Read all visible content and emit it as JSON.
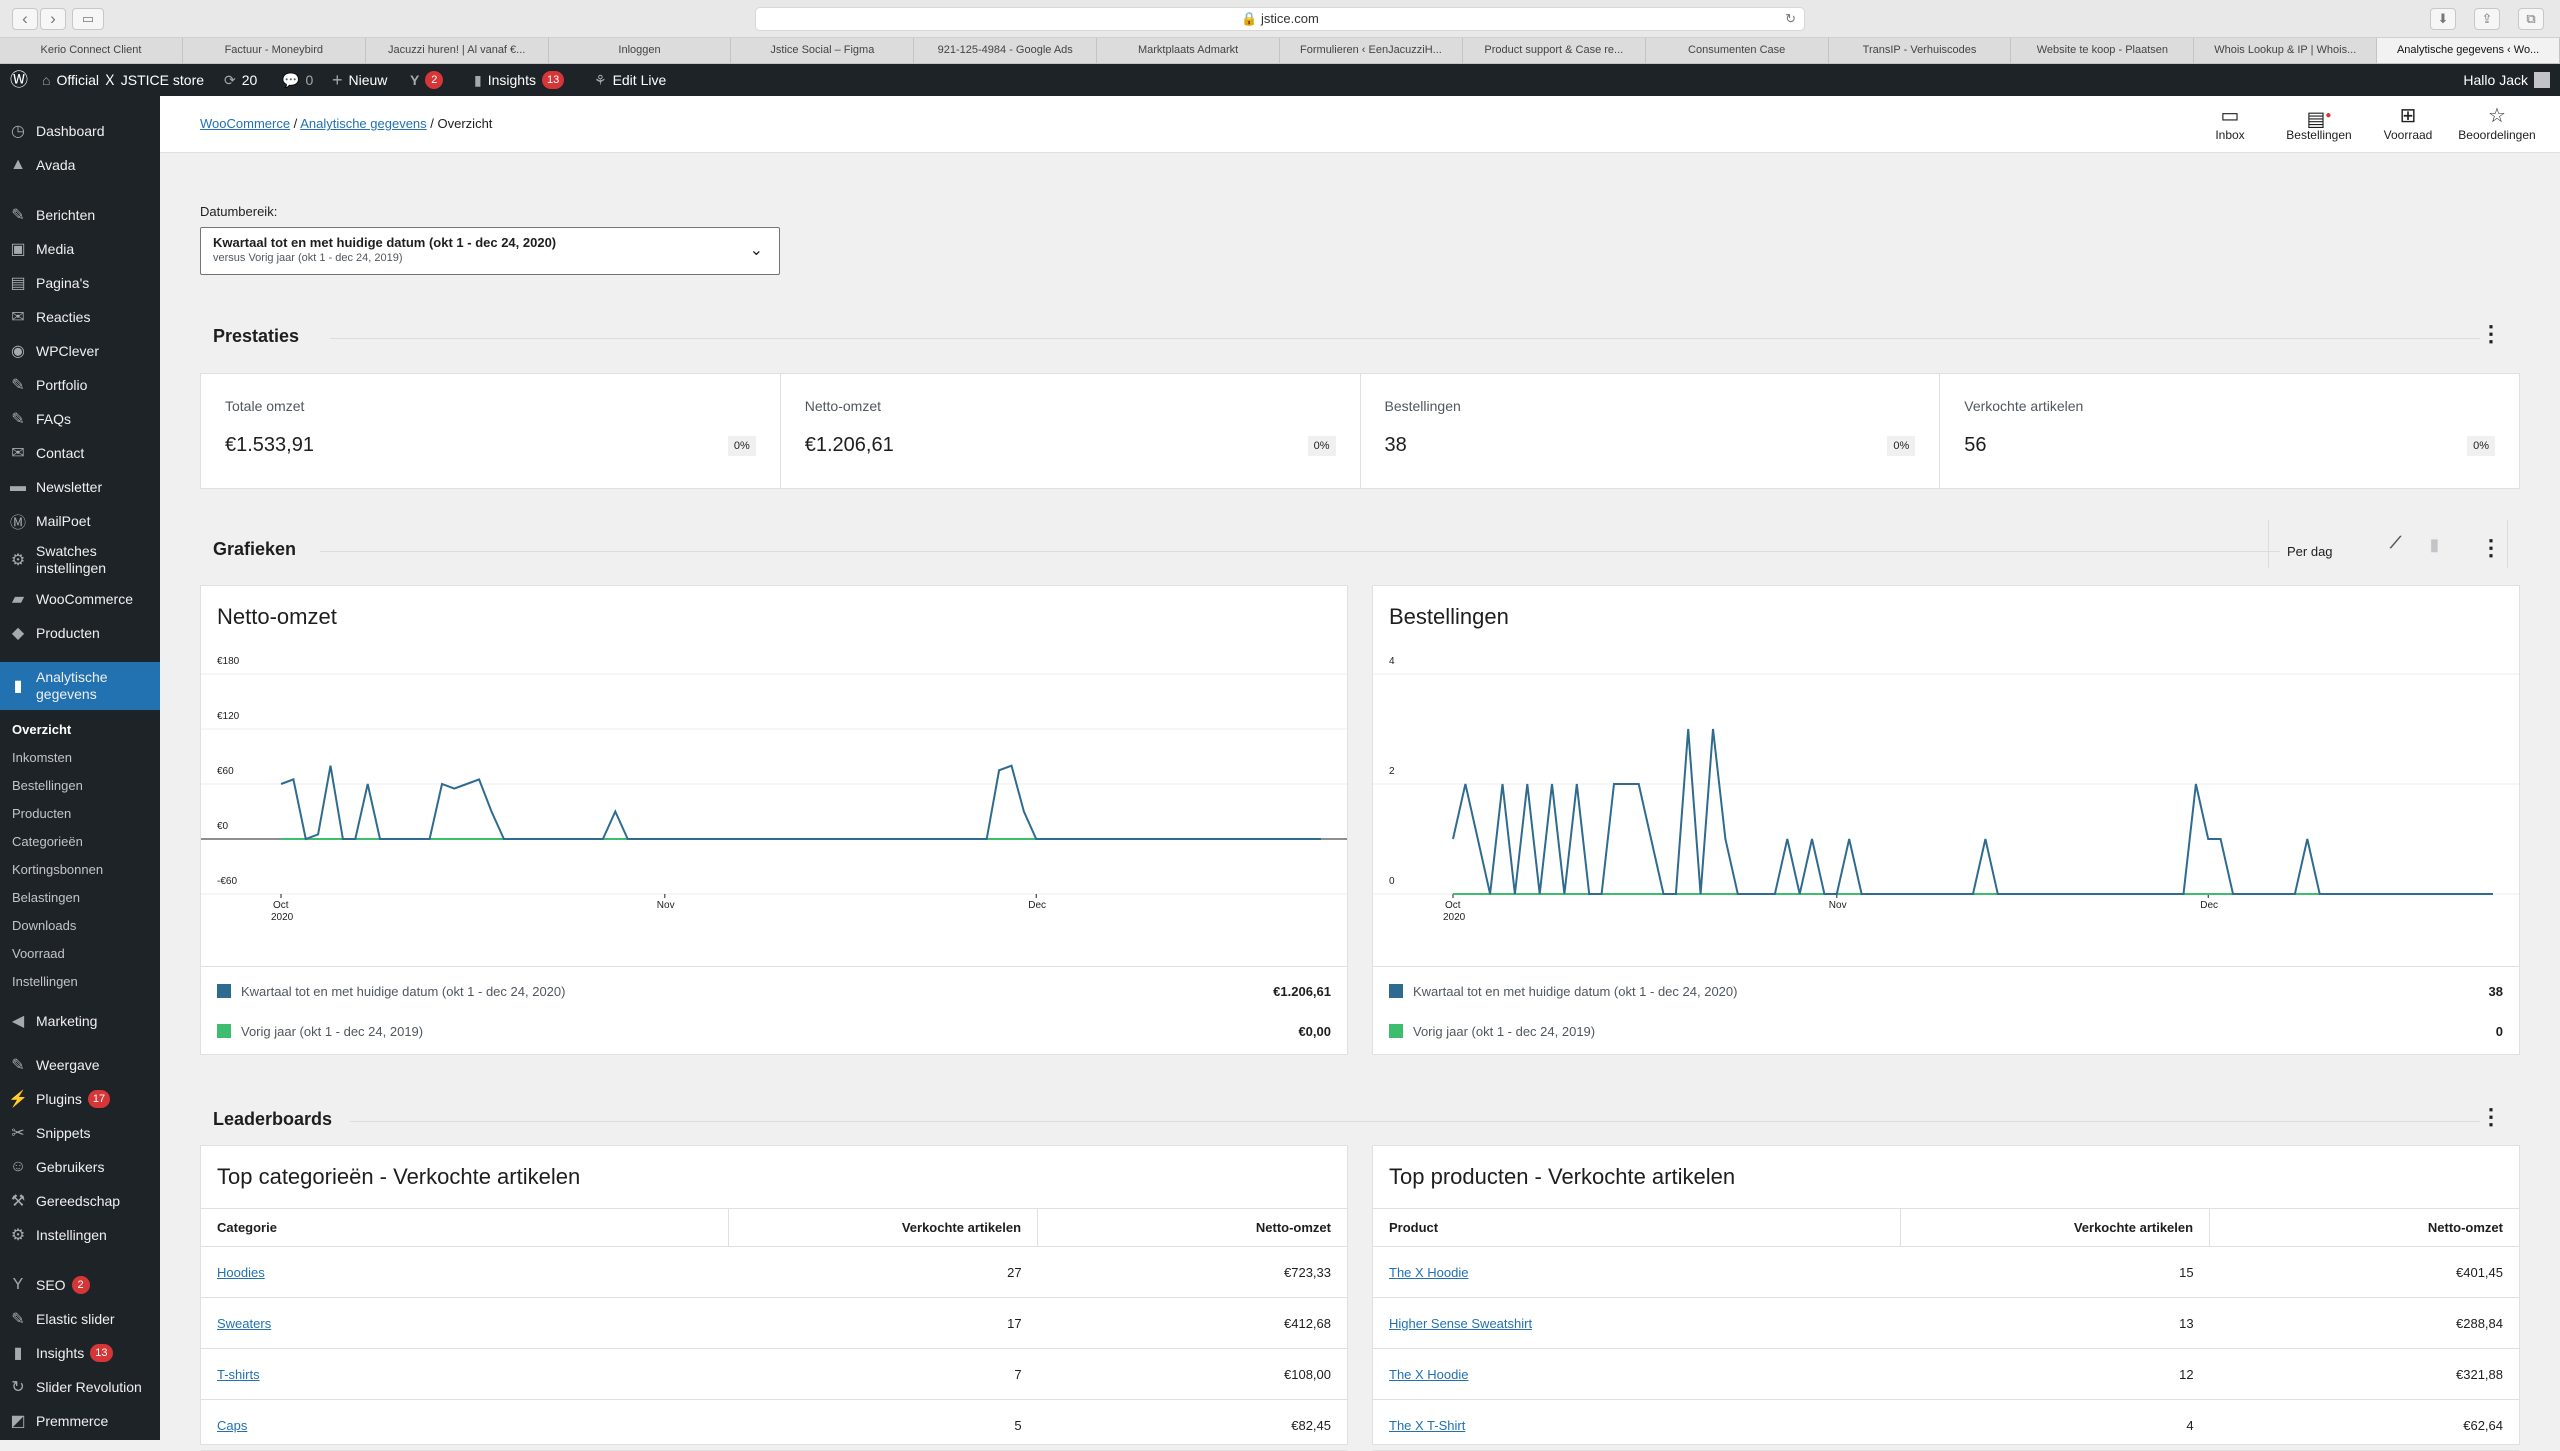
{
  "browser": {
    "url": "jstice.com",
    "tabs": [
      "Kerio Connect Client",
      "Factuur - Moneybird",
      "Jacuzzi huren! | Al vanaf €...",
      "Inloggen",
      "Jstice Social – Figma",
      "921-125-4984 - Google Ads",
      "Marktplaats Admarkt",
      "Formulieren ‹ EenJacuzziH...",
      "Product support & Case re...",
      "Consumenten Case",
      "TransIP - Verhuiscodes",
      "Website te koop - Plaatsen",
      "Whois Lookup & IP | Whois...",
      "Analytische gegevens ‹ Wo..."
    ]
  },
  "adminbar": {
    "site": "Official Ｘ JSTICE store",
    "updates": "20",
    "comments": "0",
    "new": "Nieuw",
    "yoast_badge": "2",
    "insights": "Insights",
    "insights_badge": "13",
    "edit_live": "Edit Live",
    "greeting": "Hallo Jack"
  },
  "sidebar": {
    "items": [
      {
        "label": "Dashboard",
        "icon": "dashboard-icon"
      },
      {
        "label": "Avada",
        "icon": "avada-icon"
      },
      {
        "label": "Berichten",
        "icon": "pin-icon"
      },
      {
        "label": "Media",
        "icon": "media-icon"
      },
      {
        "label": "Pagina's",
        "icon": "page-icon"
      },
      {
        "label": "Reacties",
        "icon": "comment-icon"
      },
      {
        "label": "WPClever",
        "icon": "wpclever-icon"
      },
      {
        "label": "Portfolio",
        "icon": "pin-icon"
      },
      {
        "label": "FAQs",
        "icon": "pin-icon"
      },
      {
        "label": "Contact",
        "icon": "mail-icon"
      },
      {
        "label": "Newsletter",
        "icon": "newsletter-icon"
      },
      {
        "label": "MailPoet",
        "icon": "mailpoet-icon"
      },
      {
        "label": "Swatches instellingen",
        "icon": "gear-icon"
      },
      {
        "label": "WooCommerce",
        "icon": "woo-icon"
      },
      {
        "label": "Producten",
        "icon": "box-icon"
      },
      {
        "label": "Analytische gegevens",
        "icon": "chart-icon"
      }
    ],
    "subitems": [
      "Overzicht",
      "Inkomsten",
      "Bestellingen",
      "Producten",
      "Categorieën",
      "Kortingsbonnen",
      "Belastingen",
      "Downloads",
      "Voorraad",
      "Instellingen"
    ],
    "items2": [
      {
        "label": "Marketing",
        "icon": "megaphone-icon"
      },
      {
        "label": "Weergave",
        "icon": "brush-icon"
      },
      {
        "label": "Plugins",
        "icon": "plugin-icon",
        "badge": "17"
      },
      {
        "label": "Snippets",
        "icon": "scissors-icon"
      },
      {
        "label": "Gebruikers",
        "icon": "user-icon"
      },
      {
        "label": "Gereedschap",
        "icon": "wrench-icon"
      },
      {
        "label": "Instellingen",
        "icon": "settings-icon"
      },
      {
        "label": "SEO",
        "icon": "yoast-icon",
        "badge": "2"
      },
      {
        "label": "Elastic slider",
        "icon": "pin-icon"
      },
      {
        "label": "Insights",
        "icon": "insights-icon",
        "badge": "13"
      },
      {
        "label": "Slider Revolution",
        "icon": "refresh-icon"
      },
      {
        "label": "Premmerce",
        "icon": "premmerce-icon"
      }
    ]
  },
  "header": {
    "breadcrumb": [
      "WooCommerce",
      "Analytische gegevens",
      "Overzicht"
    ],
    "actions": [
      "Inbox",
      "Bestellingen",
      "Voorraad",
      "Beoordelingen"
    ]
  },
  "daterange": {
    "label": "Datumbereik:",
    "main": "Kwartaal tot en met huidige datum (okt 1 - dec 24, 2020)",
    "compare": "versus Vorig jaar (okt 1 - dec 24, 2019)"
  },
  "performance": {
    "title": "Prestaties",
    "cards": [
      {
        "label": "Totale omzet",
        "value": "€1.533,91",
        "delta": "0%"
      },
      {
        "label": "Netto-omzet",
        "value": "€1.206,61",
        "delta": "0%"
      },
      {
        "label": "Bestellingen",
        "value": "38",
        "delta": "0%"
      },
      {
        "label": "Verkochte artikelen",
        "value": "56",
        "delta": "0%"
      }
    ]
  },
  "charts_section": {
    "title": "Grafieken",
    "interval": "Per dag"
  },
  "charts": [
    {
      "title": "Netto-omzet",
      "legend": [
        {
          "label": "Kwartaal tot en met huidige datum (okt 1 - dec 24, 2020)",
          "value": "€1.206,61",
          "color": "#2e6b8f"
        },
        {
          "label": "Vorig jaar (okt 1 - dec 24, 2019)",
          "value": "€0,00",
          "color": "#3ebd6e"
        }
      ]
    },
    {
      "title": "Bestellingen",
      "legend": [
        {
          "label": "Kwartaal tot en met huidige datum (okt 1 - dec 24, 2020)",
          "value": "38",
          "color": "#2e6b8f"
        },
        {
          "label": "Vorig jaar (okt 1 - dec 24, 2019)",
          "value": "0",
          "color": "#3ebd6e"
        }
      ]
    }
  ],
  "chart_data": [
    {
      "type": "line",
      "title": "Netto-omzet",
      "yticks": [
        "€180",
        "€120",
        "€60",
        "€0",
        "-€60"
      ],
      "ylim": [
        -60,
        180
      ],
      "xticks": [
        {
          "label": "Oct",
          "sub": "2020",
          "day": 1
        },
        {
          "label": "Nov",
          "sub": "",
          "day": 32
        },
        {
          "label": "Dec",
          "sub": "",
          "day": 62
        }
      ],
      "series": [
        {
          "name": "Kwartaal tot en met huidige datum (okt 1 - dec 24, 2020)",
          "color": "#2e6b8f",
          "values": [
            60,
            65,
            0,
            5,
            80,
            0,
            0,
            60,
            0,
            0,
            0,
            0,
            0,
            60,
            55,
            60,
            65,
            30,
            0,
            0,
            0,
            0,
            0,
            0,
            0,
            0,
            0,
            30,
            0,
            0,
            0,
            0,
            0,
            0,
            0,
            0,
            0,
            0,
            0,
            0,
            0,
            0,
            0,
            0,
            0,
            0,
            0,
            0,
            0,
            0,
            0,
            0,
            0,
            0,
            0,
            0,
            0,
            0,
            75,
            80,
            30,
            0,
            0,
            0,
            0,
            0,
            0,
            0,
            0,
            0,
            0,
            0,
            0,
            0,
            0,
            0,
            0,
            0,
            0,
            0,
            0,
            0,
            0,
            0,
            0
          ]
        },
        {
          "name": "Vorig jaar (okt 1 - dec 24, 2019)",
          "color": "#3ebd6e",
          "values": [
            0,
            0,
            0,
            0,
            0,
            0,
            0,
            0,
            0,
            0,
            0,
            0,
            0,
            0,
            0,
            0,
            0,
            0,
            0,
            0,
            0,
            0,
            0,
            0,
            0,
            0,
            0,
            0,
            0,
            0,
            0,
            0,
            0,
            0,
            0,
            0,
            0,
            0,
            0,
            0,
            0,
            0,
            0,
            0,
            0,
            0,
            0,
            0,
            0,
            0,
            0,
            0,
            0,
            0,
            0,
            0,
            0,
            0,
            0,
            0,
            0,
            0,
            0,
            0,
            0,
            0,
            0,
            0,
            0,
            0,
            0,
            0,
            0,
            0,
            0,
            0,
            0,
            0,
            0,
            0,
            0,
            0,
            0,
            0,
            0
          ]
        }
      ]
    },
    {
      "type": "line",
      "title": "Bestellingen",
      "yticks": [
        "4",
        "2",
        "0"
      ],
      "ylim": [
        0,
        4
      ],
      "xticks": [
        {
          "label": "Oct",
          "sub": "2020",
          "day": 1
        },
        {
          "label": "Nov",
          "sub": "",
          "day": 32
        },
        {
          "label": "Dec",
          "sub": "",
          "day": 62
        }
      ],
      "series": [
        {
          "name": "Kwartaal tot en met huidige datum (okt 1 - dec 24, 2020)",
          "color": "#2e6b8f",
          "values": [
            1,
            2,
            1,
            0,
            2,
            0,
            2,
            0,
            2,
            0,
            2,
            0,
            0,
            2,
            2,
            2,
            1,
            0,
            0,
            3,
            0,
            3,
            1,
            0,
            0,
            0,
            0,
            1,
            0,
            1,
            0,
            0,
            1,
            0,
            0,
            0,
            0,
            0,
            0,
            0,
            0,
            0,
            0,
            1,
            0,
            0,
            0,
            0,
            0,
            0,
            0,
            0,
            0,
            0,
            0,
            0,
            0,
            0,
            0,
            0,
            2,
            1,
            1,
            0,
            0,
            0,
            0,
            0,
            0,
            1,
            0,
            0,
            0,
            0,
            0,
            0,
            0,
            0,
            0,
            0,
            0,
            0,
            0,
            0,
            0
          ]
        },
        {
          "name": "Vorig jaar (okt 1 - dec 24, 2019)",
          "color": "#3ebd6e",
          "values": [
            0,
            0,
            0,
            0,
            0,
            0,
            0,
            0,
            0,
            0,
            0,
            0,
            0,
            0,
            0,
            0,
            0,
            0,
            0,
            0,
            0,
            0,
            0,
            0,
            0,
            0,
            0,
            0,
            0,
            0,
            0,
            0,
            0,
            0,
            0,
            0,
            0,
            0,
            0,
            0,
            0,
            0,
            0,
            0,
            0,
            0,
            0,
            0,
            0,
            0,
            0,
            0,
            0,
            0,
            0,
            0,
            0,
            0,
            0,
            0,
            0,
            0,
            0,
            0,
            0,
            0,
            0,
            0,
            0,
            0,
            0,
            0,
            0,
            0,
            0,
            0,
            0,
            0,
            0,
            0,
            0,
            0,
            0,
            0,
            0
          ]
        }
      ]
    }
  ],
  "leaderboards": {
    "title": "Leaderboards",
    "categories": {
      "title": "Top categorieën - Verkochte artikelen",
      "headers": [
        "Categorie",
        "Verkochte artikelen",
        "Netto-omzet"
      ],
      "rows": [
        [
          "Hoodies",
          "27",
          "€723,33"
        ],
        [
          "Sweaters",
          "17",
          "€412,68"
        ],
        [
          "T-shirts",
          "7",
          "€108,00"
        ],
        [
          "Caps",
          "5",
          "€82,45"
        ]
      ]
    },
    "products": {
      "title": "Top producten - Verkochte artikelen",
      "headers": [
        "Product",
        "Verkochte artikelen",
        "Netto-omzet"
      ],
      "rows": [
        [
          "The X Hoodie",
          "15",
          "€401,45"
        ],
        [
          "Higher Sense Sweatshirt",
          "13",
          "€288,84"
        ],
        [
          "The X Hoodie",
          "12",
          "€321,88"
        ],
        [
          "The X T-Shirt",
          "4",
          "€62,64"
        ]
      ]
    }
  }
}
